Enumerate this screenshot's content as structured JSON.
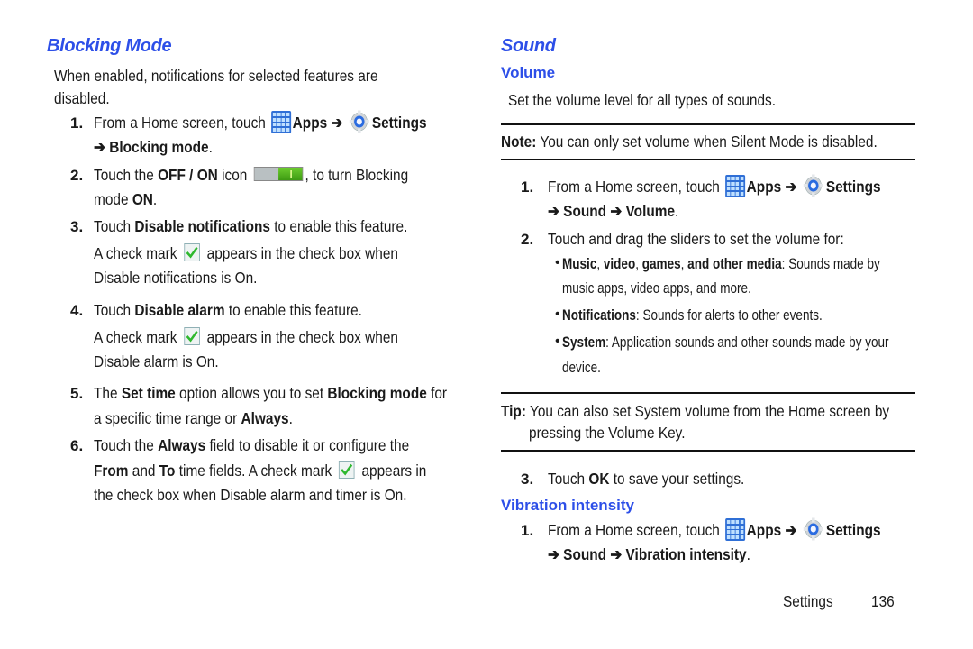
{
  "left": {
    "title": "Blocking Mode",
    "intro_1": "When enabled, notifications for selected features are",
    "intro_2": "disabled.",
    "steps": [
      {
        "num": "1.",
        "pre": "From a Home screen, touch",
        "apps": "Apps",
        "arrow": "➔",
        "settings": "Settings",
        "line2_arrow": "➔",
        "line2_bold": "Blocking mode",
        "line2_end": "."
      },
      {
        "num": "2.",
        "pre": "Touch the",
        "bold": "OFF / ON",
        "mid": "icon",
        "post": ", to turn Blocking",
        "line2_pre": "mode",
        "line2_bold": "ON",
        "line2_end": "."
      },
      {
        "num": "3.",
        "pre": "Touch",
        "bold": "Disable notifications",
        "post": "to enable this feature.",
        "sub_pre": "A check mark",
        "sub_post": "appears in the check box when",
        "sub_line2": "Disable notifications is On."
      },
      {
        "num": "4.",
        "pre": "Touch",
        "bold": "Disable alarm",
        "post": "to enable this feature.",
        "sub_pre": "A check mark",
        "sub_post": "appears in the check box when",
        "sub_line2": "Disable alarm is On."
      },
      {
        "num": "5.",
        "pre": "The",
        "bold": "Set time",
        "mid": "option allows you to set",
        "bold2": "Blocking mode",
        "post": "for",
        "line2_pre": "a specific time range or",
        "line2_bold": "Always",
        "line2_end": "."
      },
      {
        "num": "6.",
        "pre": "Touch the",
        "bold": "Always",
        "post": "field to disable it or configure the",
        "line2_bold": "From",
        "line2_mid": "and",
        "line2_bold2": "To",
        "line2_post": "time fields. A check mark",
        "line2_end": "appears in",
        "line3": "the check box when Disable alarm and timer is On."
      }
    ]
  },
  "right": {
    "title": "Sound",
    "volume": {
      "heading": "Volume",
      "intro": "Set the volume level for all types of sounds.",
      "note_label": "Note:",
      "note_text": "You can only set volume when Silent Mode is disabled.",
      "steps": [
        {
          "num": "1.",
          "pre": "From a Home screen, touch",
          "apps": "Apps",
          "arrow": "➔",
          "settings": "Settings",
          "line2": "➔ Sound ➔ Volume",
          "line2_end": "."
        },
        {
          "num": "2.",
          "text": "Touch and drag the sliders to set the volume for:"
        }
      ],
      "bullets": [
        {
          "bold": "Music",
          "sep1": ",",
          "bold2": "video",
          "sep2": ",",
          "bold3": "games",
          "sep3": ",",
          "bold4": "and other media",
          "text": ": Sounds made by",
          "line2": "music apps, video apps, and more."
        },
        {
          "bold": "Notifications",
          "text": ": Sounds for alerts to other events."
        },
        {
          "bold": "System",
          "text": ": Application sounds and other sounds made by your",
          "line2": "device."
        }
      ],
      "tip_label": "Tip:",
      "tip_text": "You can also set System volume from the Home screen by",
      "tip_line2": "pressing the Volume Key.",
      "step3": {
        "num": "3.",
        "pre": "Touch",
        "bold": "OK",
        "post": "to save your settings."
      }
    },
    "vibration": {
      "heading": "Vibration intensity",
      "step1": {
        "num": "1.",
        "pre": "From a Home screen, touch",
        "apps": "Apps",
        "arrow": "➔",
        "settings": "Settings",
        "line2": "➔ Sound ➔ Vibration intensity",
        "line2_end": "."
      }
    }
  },
  "footer": {
    "section": "Settings",
    "page": "136"
  },
  "colors": {
    "heading": "#2d4fe8",
    "apps_icon": "#2f6fd6",
    "toggle_on": "#4caf1a",
    "check": "#2eb82e"
  }
}
